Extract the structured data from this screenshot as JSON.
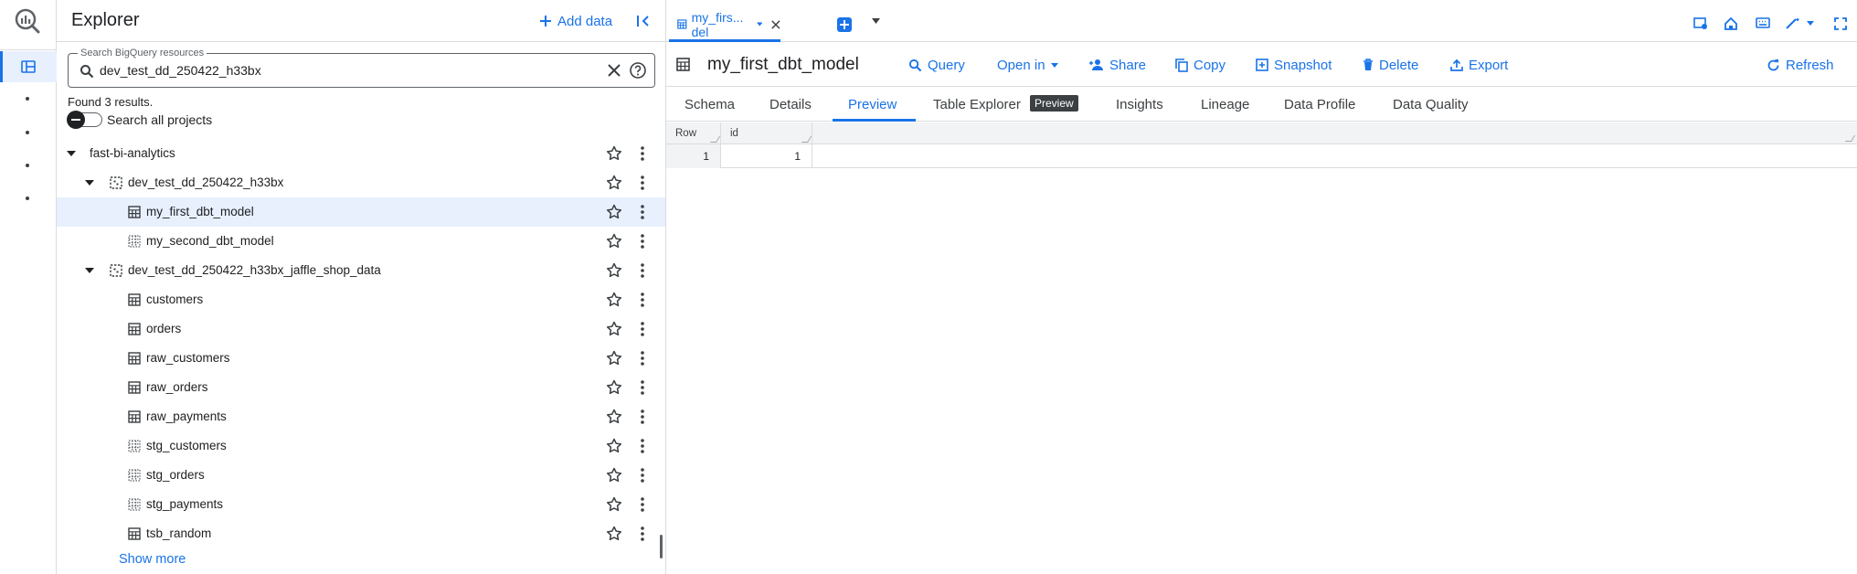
{
  "explorer": {
    "title": "Explorer",
    "add_data": "Add data",
    "search_label": "Search BigQuery resources",
    "search_value": "dev_test_dd_250422_h33bx",
    "found_text": "Found 3 results.",
    "search_all_label": "Search all projects",
    "show_more": "Show more"
  },
  "tree": [
    {
      "label": "fast-bi-analytics",
      "type": "project"
    },
    {
      "label": "dev_test_dd_250422_h33bx",
      "type": "dataset"
    },
    {
      "label": "my_first_dbt_model",
      "type": "table",
      "selected": true
    },
    {
      "label": "my_second_dbt_model",
      "type": "view"
    },
    {
      "label": "dev_test_dd_250422_h33bx_jaffle_shop_data",
      "type": "dataset"
    },
    {
      "label": "customers",
      "type": "table"
    },
    {
      "label": "orders",
      "type": "table"
    },
    {
      "label": "raw_customers",
      "type": "table"
    },
    {
      "label": "raw_orders",
      "type": "table"
    },
    {
      "label": "raw_payments",
      "type": "table"
    },
    {
      "label": "stg_customers",
      "type": "view"
    },
    {
      "label": "stg_orders",
      "type": "view"
    },
    {
      "label": "stg_payments",
      "type": "view"
    },
    {
      "label": "tsb_random",
      "type": "table"
    }
  ],
  "tab": {
    "label": "my_firs... del"
  },
  "toolbar": {
    "title": "my_first_dbt_model",
    "query": "Query",
    "open_in": "Open in",
    "share": "Share",
    "copy": "Copy",
    "snapshot": "Snapshot",
    "delete": "Delete",
    "export": "Export",
    "refresh": "Refresh"
  },
  "subtabs": {
    "schema": "Schema",
    "details": "Details",
    "preview": "Preview",
    "table_explorer": "Table Explorer",
    "table_explorer_badge": "Preview",
    "insights": "Insights",
    "lineage": "Lineage",
    "data_profile": "Data Profile",
    "data_quality": "Data Quality"
  },
  "grid": {
    "headers": [
      "Row",
      "id"
    ],
    "rows": [
      [
        "1",
        "1"
      ]
    ]
  },
  "colors": {
    "accent": "#1a73e8",
    "selected_bg": "#e8f0fe",
    "border": "#dadce0"
  }
}
